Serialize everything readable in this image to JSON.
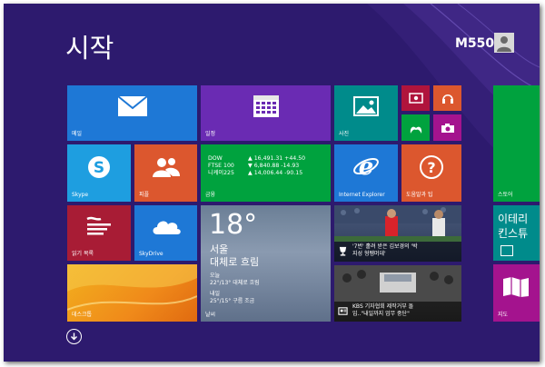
{
  "screen": {
    "title": "시작",
    "user_name": "M550"
  },
  "colors": {
    "background": "#2d1a6e",
    "blue": "#1e78d6",
    "orange": "#dc572e",
    "purple": "#6a2bb3",
    "green": "#00a23e",
    "red": "#a81c35",
    "teal": "#008b8b",
    "magenta": "#a4138e"
  },
  "tiles": {
    "mail": {
      "label": "메일"
    },
    "calendar": {
      "label": "일정"
    },
    "photos": {
      "label": "사진"
    },
    "skype": {
      "label": "Skype"
    },
    "people": {
      "label": "피플"
    },
    "finance": {
      "label": "금융",
      "rows": [
        {
          "name": "DOW",
          "value": "▲ 16,491.31 +44.50"
        },
        {
          "name": "FTSE 100",
          "value": "▼ 6,840.88 -14.93"
        },
        {
          "name": "니케이225",
          "value": "▲ 14,006.44 -90.15"
        }
      ]
    },
    "ie": {
      "label": "Internet Explorer"
    },
    "help": {
      "label": "도움말과 팁"
    },
    "store": {
      "label": "스토어"
    },
    "reading": {
      "label": "읽기 목록"
    },
    "skydrive": {
      "label": "SkyDrive"
    },
    "weather": {
      "temp": "18°",
      "city": "서울",
      "condition": "대체로 흐림",
      "today_label": "오늘",
      "today_detail": "22°/13° 대체로 흐림",
      "tomorrow_label": "내일",
      "tomorrow_detail": "25°/15° 구름 조금",
      "label": "날씨"
    },
    "news1": {
      "line1": "'7번' 홀려 받은 김보경의 '박",
      "line2": "지성 형펭머데'"
    },
    "news2": {
      "line1": "KBS 기자협회 제작거부 돌",
      "line2": "입..\"내일까지 업무 중단\""
    },
    "tetris": {
      "line1": "이테리",
      "line2": "킨스튜"
    },
    "desktop": {
      "label": "데스크톱"
    },
    "maps": {
      "label": "지도"
    }
  }
}
